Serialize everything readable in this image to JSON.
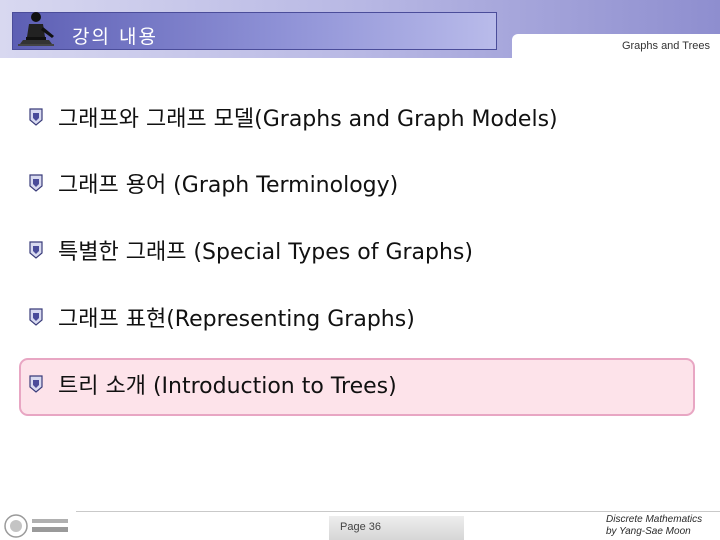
{
  "header": {
    "title": "강의 내용",
    "subtitle": "Graphs and Trees"
  },
  "outline": {
    "items": [
      {
        "label": "그래프와 그래프 모델(Graphs and Graph Models)"
      },
      {
        "label": "그래프 용어 (Graph Terminology)"
      },
      {
        "label": "특별한 그래프 (Special Types of Graphs)"
      },
      {
        "label": "그래프 표현(Representing Graphs)"
      },
      {
        "label": "트리 소개 (Introduction to Trees)",
        "highlighted": true
      }
    ],
    "bullet_icon": "emblem-bullet-icon"
  },
  "footer": {
    "page": "Page 36",
    "credit_line1": "Discrete Mathematics",
    "credit_line2": "by Yang-Sae Moon"
  },
  "colors": {
    "title_box": "#5d5fb4",
    "highlight_fill": "#fde3ea",
    "highlight_border": "#e8a6c3"
  }
}
